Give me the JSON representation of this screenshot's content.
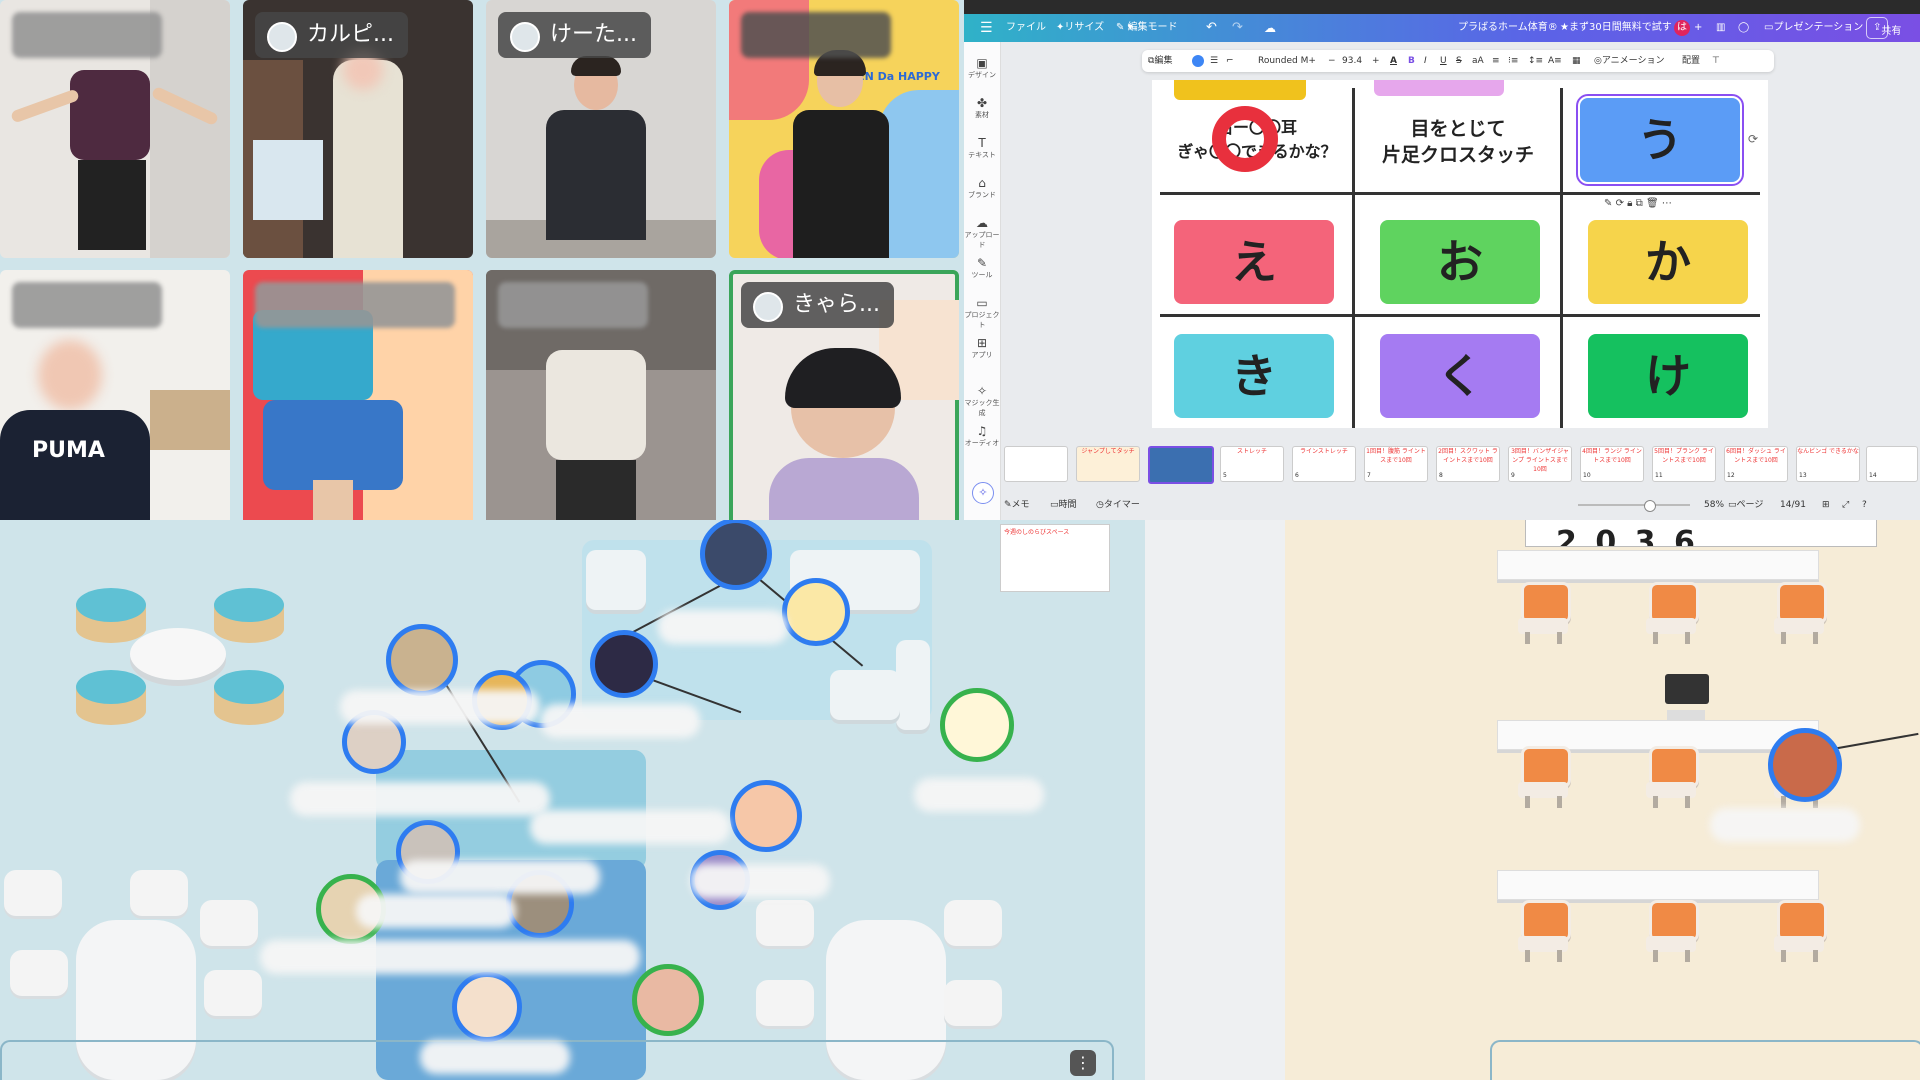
{
  "video_grid": {
    "tiles": [
      {
        "name": "",
        "blurred_name": true
      },
      {
        "name": "カルピ...",
        "blurred_name": false
      },
      {
        "name": "けーた...",
        "blurred_name": false
      },
      {
        "name": "",
        "blurred_name": true
      },
      {
        "name": "",
        "blurred_name": true
      },
      {
        "name": "",
        "blurred_name": true
      },
      {
        "name": "",
        "blurred_name": true
      },
      {
        "name": "きゃら...",
        "blurred_name": false,
        "active_speaker": true
      }
    ],
    "shirt_text": "PUMA",
    "poster_text": "PEN Da HAPPY"
  },
  "canva": {
    "topbar": {
      "menu_icon": "menu-icon",
      "file": "ファイル",
      "resize": "リサイズ",
      "edit_mode": "編集モード",
      "doc_title": "プラばるホーム体育®",
      "trial": "まず30日間無料で試す",
      "avatar_letter": "は",
      "present": "プレゼンテーション",
      "share": "共有"
    },
    "toolbar": {
      "edit": "編集",
      "font": "Rounded M+",
      "font_size": "93.4",
      "animation": "アニメーション",
      "arrange": "配置"
    },
    "sidebar": [
      "デザイン",
      "素材",
      "テキスト",
      "ブランド",
      "アップロード",
      "ツール",
      "プロジェクト",
      "アプリ",
      "マジック生成",
      "オーディオ"
    ],
    "slide": {
      "cell_1": "右ー〇〇耳\nぎゃ〇〇できるかな？",
      "cell_2": "目をとじて\n片足クロスタッチ",
      "cards": [
        "う",
        "え",
        "お",
        "か",
        "き",
        "く",
        "け"
      ],
      "card_colors": [
        "#5b9cf6",
        "#f4647a",
        "#5fd35f",
        "#f6d44b",
        "#5fd0e0",
        "#a57bf2",
        "#15c15f"
      ]
    },
    "thumbnails": [
      {
        "num": "",
        "text": ""
      },
      {
        "num": "",
        "text": "ジャンプしてタッチ"
      },
      {
        "num": "",
        "text": ""
      },
      {
        "num": "5",
        "text": "ストレッチ"
      },
      {
        "num": "6",
        "text": "ラインストレッチ"
      },
      {
        "num": "7",
        "text": "1回目！腹筋 ライントスまで10回"
      },
      {
        "num": "8",
        "text": "2回目！スクワット ライントスまで10回"
      },
      {
        "num": "9",
        "text": "3回目！バンザイジャンプ ライントスまで10回"
      },
      {
        "num": "10",
        "text": "4回目！ランジ ライントスまで10回"
      },
      {
        "num": "11",
        "text": "5回目！プランク ライントスまで10回"
      },
      {
        "num": "12",
        "text": "6回目！ダッシュ ライントスまで10回"
      },
      {
        "num": "13",
        "text": "なんビンゴ できるかな"
      },
      {
        "num": "14",
        "text": ""
      }
    ],
    "bottombar": {
      "notes": "メモ",
      "duration": "時間",
      "timer": "タイマー",
      "zoom": "58%",
      "pages_label": "ページ",
      "page_count": "14/91"
    }
  },
  "space": {
    "whiteboard_year": "2 0 3 6",
    "notice_title": "今週のしのらびスペース",
    "menu_icon": "more-vertical-icon"
  }
}
